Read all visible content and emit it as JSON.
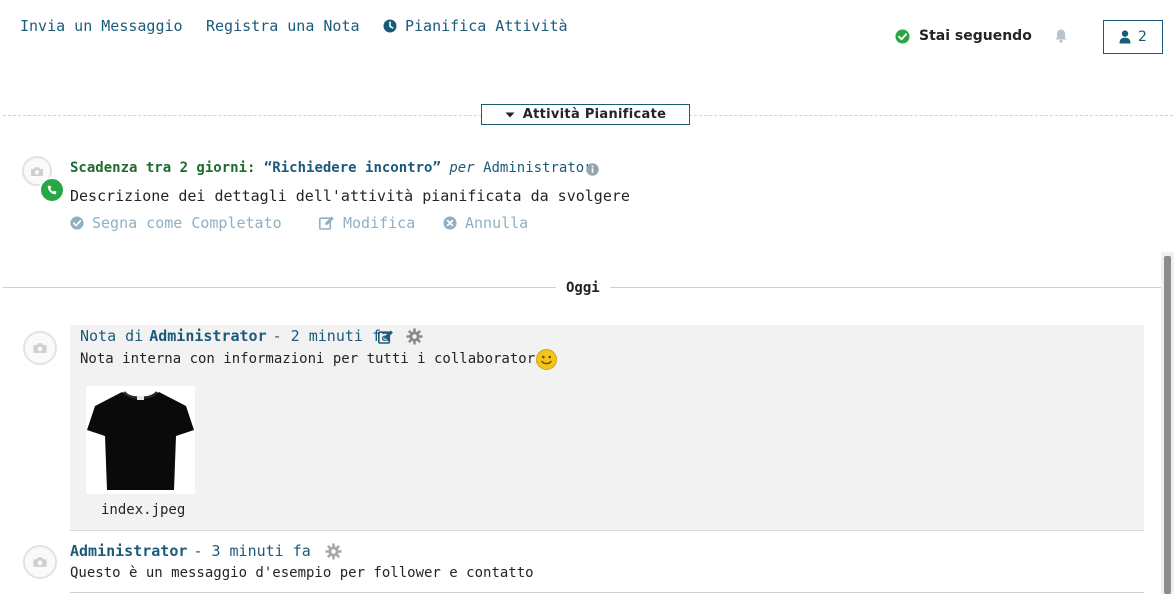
{
  "topbar": {
    "send_message": "Invia un Messaggio",
    "log_note": "Registra una Nota",
    "schedule_activity": "Pianifica Attività",
    "following_label": "Stai seguendo",
    "followers_count": "2"
  },
  "planned": {
    "toggle_label": "Attività Pianificate",
    "activity": {
      "deadline": "Scadenza tra 2 giorni:",
      "summary": "“Richiedere incontro”",
      "per": "per",
      "creator": "Administrator",
      "description": "Descrizione dei dettagli dell'attività pianificata da svolgere",
      "mark_done": "Segna come Completato",
      "edit": "Modifica",
      "cancel": "Annulla"
    }
  },
  "thread": {
    "day_label": "Oggi",
    "note": {
      "prefix": "Nota di",
      "author": "Administrator",
      "date": "- 2 minuti fa",
      "body": "Nota interna con informazioni per tutti i collaboratori",
      "attachment_name": "index.jpeg"
    },
    "message": {
      "author": "Administrator",
      "date": "- 3 minuti fa",
      "body": "Questo è un messaggio d'esempio per follower e contatto"
    }
  },
  "colors": {
    "link": "#1c5a7a",
    "deadline_green": "#1e6b2e",
    "muted_action": "#8fb0c2",
    "note_bg": "#f2f2f2"
  }
}
